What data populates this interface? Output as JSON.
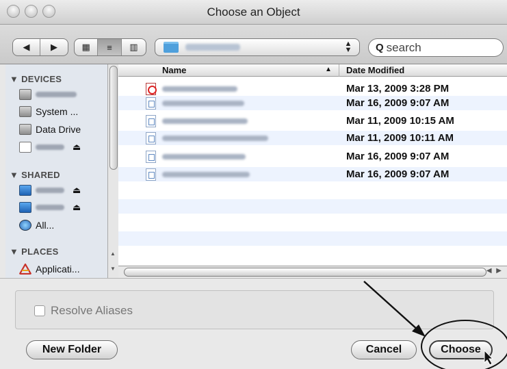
{
  "window": {
    "title": "Choose an Object"
  },
  "toolbar": {
    "back_icon": "◀",
    "forward_icon": "▶",
    "view_icon_grid": "▦",
    "view_icon_list": "≡",
    "view_icon_columns": "▥",
    "search_placeholder": "search"
  },
  "sidebar": {
    "sections": [
      {
        "title": "DEVICES"
      },
      {
        "title": "SHARED"
      },
      {
        "title": "PLACES"
      }
    ],
    "items": [
      {
        "label": "System ...",
        "icon": "hard-disk-icon"
      },
      {
        "label": "Data Drive",
        "icon": "hard-disk-icon"
      },
      {
        "label": "All...",
        "icon": "network-globe-icon"
      },
      {
        "label": "Applicati...",
        "icon": "applications-icon"
      }
    ]
  },
  "file_list": {
    "columns": {
      "name": "Name",
      "date": "Date Modified"
    },
    "rows": [
      {
        "type": "pdf",
        "date": "Mar 13, 2009 3:28 PM"
      },
      {
        "type": "doc",
        "date": "Mar 16, 2009 9:07 AM"
      },
      {
        "type": "doc",
        "date": "Mar 11, 2009 10:15 AM"
      },
      {
        "type": "doc",
        "date": "Mar 11, 2009 10:11 AM"
      },
      {
        "type": "doc",
        "date": "Mar 16, 2009 9:07 AM"
      },
      {
        "type": "doc",
        "date": "Mar 16, 2009 9:07 AM"
      }
    ]
  },
  "options": {
    "resolve_aliases_label": "Resolve Aliases",
    "resolve_aliases_checked": false
  },
  "buttons": {
    "new_folder": "New Folder",
    "cancel": "Cancel",
    "choose": "Choose"
  }
}
